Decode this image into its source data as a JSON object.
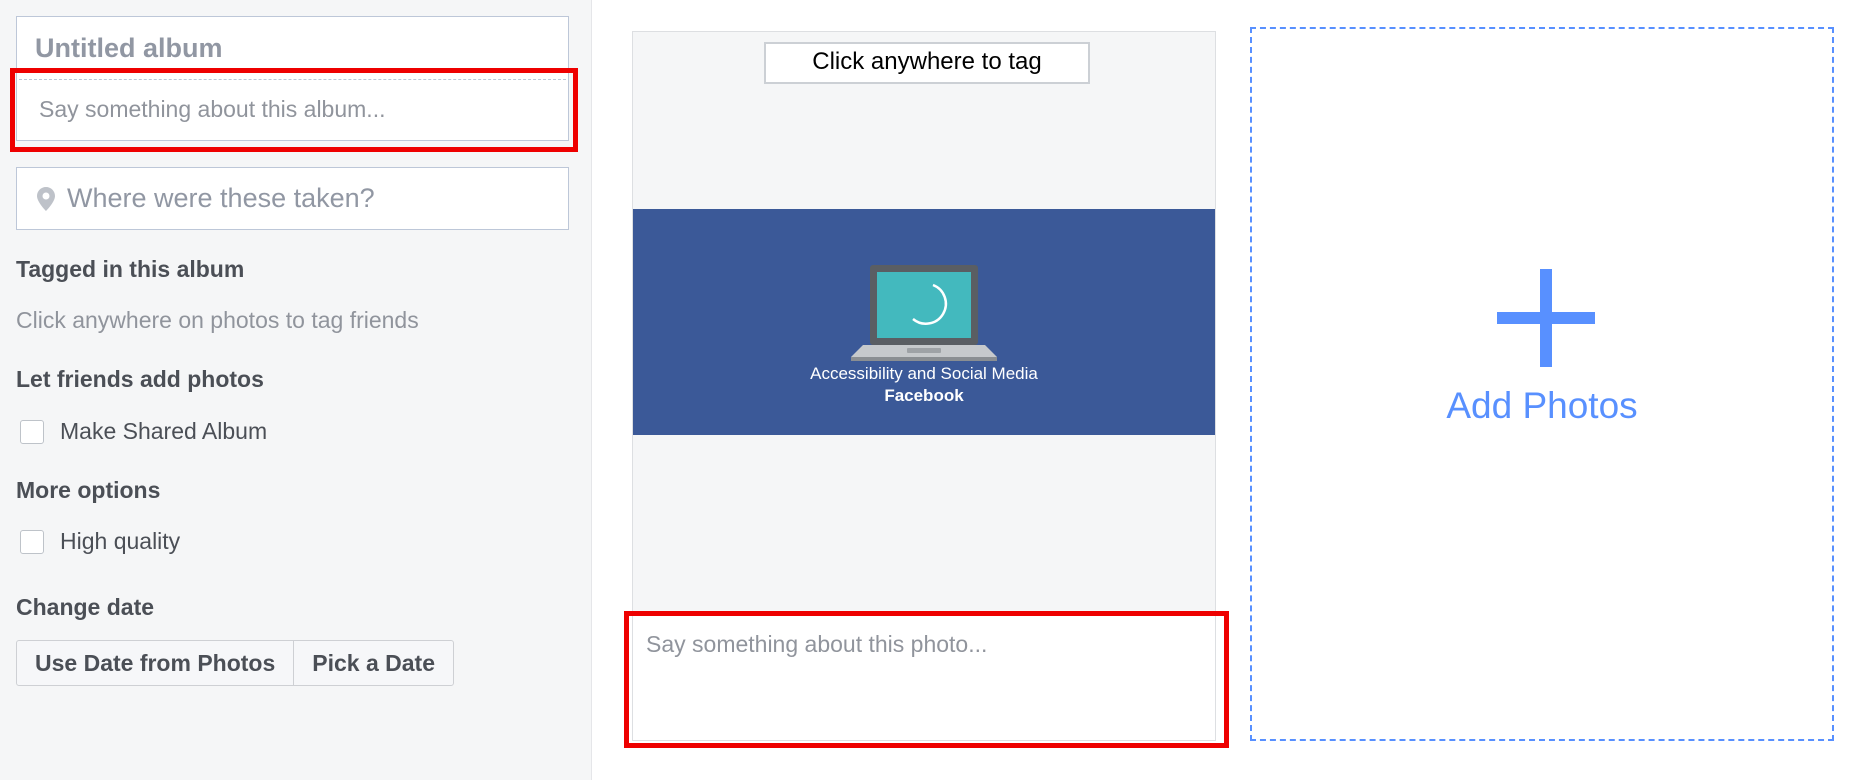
{
  "album": {
    "title_placeholder": "Untitled album",
    "description_placeholder": "Say something about this album...",
    "location_placeholder": "Where were these taken?"
  },
  "sections": {
    "tagged_heading": "Tagged in this album",
    "tagged_hint": "Click anywhere on photos to tag friends",
    "friends_heading": "Let friends add photos",
    "shared_album_label": "Make Shared Album",
    "more_options_heading": "More options",
    "high_quality_label": "High quality",
    "change_date_heading": "Change date",
    "use_date_button": "Use Date from Photos",
    "pick_date_button": "Pick a Date"
  },
  "checkboxes": {
    "shared_album_checked": false,
    "high_quality_checked": false
  },
  "photo": {
    "tag_hint": "Click anywhere to tag",
    "caption_line1": "Accessibility and Social Media",
    "caption_line2": "Facebook",
    "description_placeholder": "Say something about this photo..."
  },
  "add_photos": {
    "label": "Add Photos"
  },
  "colors": {
    "accent": "#5890ff",
    "photo_background": "#3b5998",
    "highlight": "#ee0000"
  },
  "icons": [
    "location-pin-icon",
    "laptop-icon",
    "plus-icon"
  ]
}
